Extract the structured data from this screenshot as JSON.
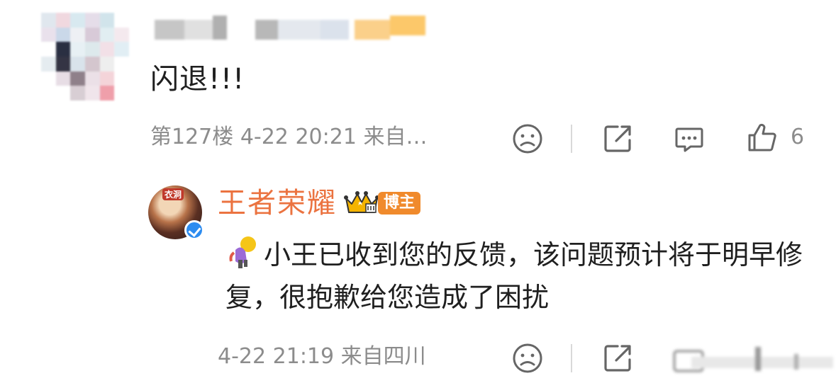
{
  "comment": {
    "text": "闪退!!!",
    "floor": "第127楼",
    "date": "4-22",
    "time": "20:21",
    "source": "来自…",
    "like_count": "6"
  },
  "reply": {
    "author": "王者荣耀",
    "badge": "博主",
    "avatar_tag": "衣洞",
    "text": "小王已收到您的反馈，该问题预计将于明早修复，很抱歉给您造成了困扰",
    "date": "4-22",
    "time": "21:19",
    "source": "来自四川"
  },
  "icons": {
    "dislike": "sad-face-icon",
    "share": "share-icon",
    "comment": "comment-icon",
    "like": "thumbs-up-icon",
    "crown": "crown-icon",
    "verified": "verified-icon",
    "emoji": "person-emoji-icon"
  },
  "colors": {
    "author_name": "#eb7340",
    "badge_bg": "#f08a2c",
    "meta_text": "#8c8c8c",
    "verified": "#2d8cf0"
  }
}
